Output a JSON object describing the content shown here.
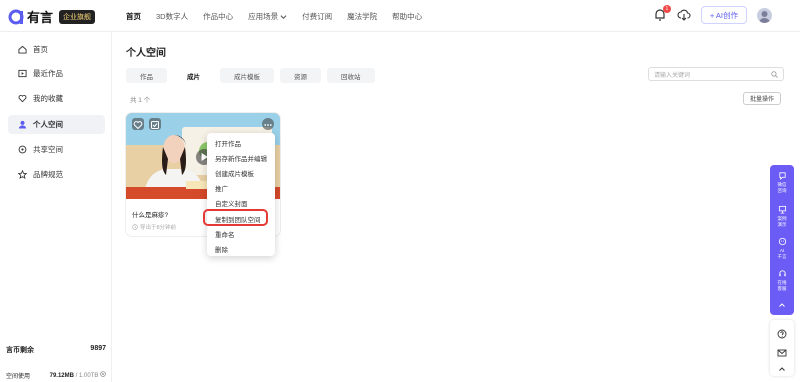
{
  "app": {
    "logo_text": "有言",
    "badge": "企业旗舰"
  },
  "topnav": [
    "首页",
    "3D数字人",
    "作品中心",
    "应用场景",
    "付费订阅",
    "魔法学院",
    "帮助中心"
  ],
  "header": {
    "notification_count": "1",
    "ai_create_label": "+ AI创作"
  },
  "sidebar": {
    "items": [
      {
        "label": "首页",
        "icon": "home-icon"
      },
      {
        "label": "最近作品",
        "icon": "recent-icon"
      },
      {
        "label": "我的收藏",
        "icon": "heart-icon"
      },
      {
        "label": "个人空间",
        "icon": "user-icon",
        "active": true
      },
      {
        "label": "共享空间",
        "icon": "share-icon"
      },
      {
        "label": "品牌规范",
        "icon": "star-icon"
      }
    ],
    "coins_label": "言币剩余",
    "coins_value": "9897",
    "storage_label": "空间使用",
    "storage_used": "79.12MB",
    "storage_total": "/ 1.00TB"
  },
  "main": {
    "title": "个人空间",
    "tabs": [
      "作品",
      "成片",
      "成片模板",
      "资源",
      "回收站"
    ],
    "active_tab": "成片",
    "search_placeholder": "请输入关键词",
    "count": "共 1 个",
    "batch_label": "批量操作"
  },
  "card": {
    "title": "什么是麻疹?",
    "meta": "导出于8分钟前"
  },
  "context_menu": [
    "打开作品",
    "另存新作品并编辑",
    "创建成片模板",
    "推广",
    "自定义封面",
    "复制到团队空间",
    "重命名",
    "删除"
  ],
  "highlighted_menu_item": "复制到团队空间",
  "float_toolbar": [
    {
      "line1": "微信",
      "line2": "咨询",
      "icon": "wechat-icon"
    },
    {
      "line1": "案例",
      "line2": "演示",
      "icon": "demo-icon"
    },
    {
      "line1": "AI",
      "line2": "千言",
      "icon": "ai-icon"
    },
    {
      "line1": "在线",
      "line2": "客服",
      "icon": "service-icon"
    }
  ],
  "colors": {
    "accent": "#6c5cf6",
    "highlight": "#e53935",
    "brand_text": "#5b5cf0"
  }
}
